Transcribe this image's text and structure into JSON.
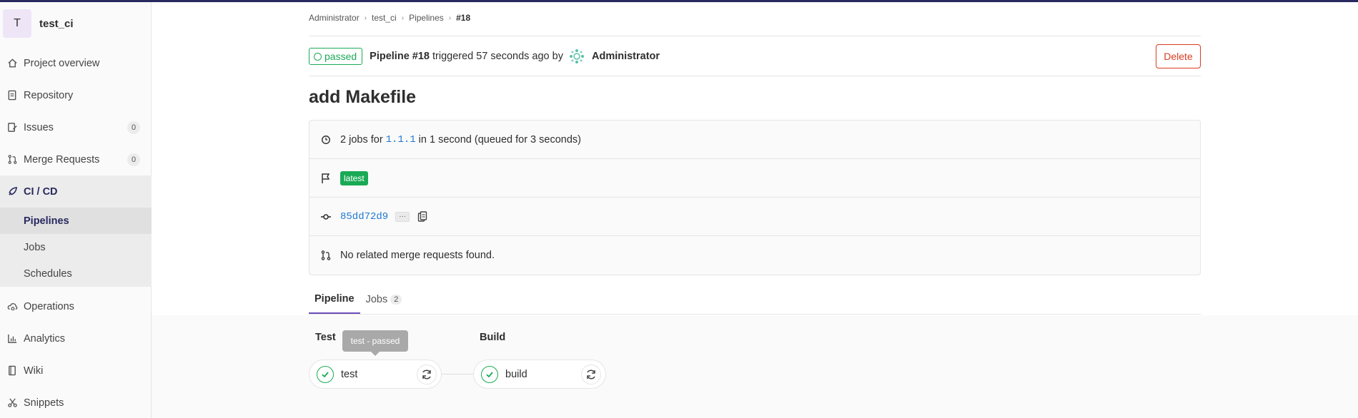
{
  "project": {
    "avatar_letter": "T",
    "name": "test_ci"
  },
  "sidebar": {
    "items": [
      {
        "label": "Project overview",
        "icon": "home-icon"
      },
      {
        "label": "Repository",
        "icon": "document-icon"
      },
      {
        "label": "Issues",
        "icon": "issues-icon",
        "count": "0"
      },
      {
        "label": "Merge Requests",
        "icon": "merge-request-icon",
        "count": "0"
      },
      {
        "label": "CI / CD",
        "icon": "rocket-icon"
      },
      {
        "label": "Operations",
        "icon": "cloud-gear-icon"
      },
      {
        "label": "Analytics",
        "icon": "chart-icon"
      },
      {
        "label": "Wiki",
        "icon": "book-icon"
      },
      {
        "label": "Snippets",
        "icon": "scissors-icon"
      }
    ],
    "cicd_sub": [
      "Pipelines",
      "Jobs",
      "Schedules"
    ]
  },
  "breadcrumb": [
    "Administrator",
    "test_ci",
    "Pipelines",
    "#18"
  ],
  "pipeline": {
    "status": "passed",
    "number": "Pipeline #18",
    "triggered_text": "triggered 57 seconds ago by",
    "user": "Administrator",
    "delete_label": "Delete",
    "title": "add Makefile"
  },
  "info": {
    "jobs_prefix": "2 jobs for",
    "ref": "1.1.1",
    "jobs_suffix": "in 1 second (queued for 3 seconds)",
    "tag": "latest",
    "commit_sha": "85dd72d9",
    "mr_text": "No related merge requests found."
  },
  "tabs": [
    {
      "label": "Pipeline"
    },
    {
      "label": "Jobs",
      "count": "2"
    }
  ],
  "graph": {
    "stages": [
      {
        "name": "Test",
        "job": "test"
      },
      {
        "name": "Build",
        "job": "build"
      }
    ],
    "tooltip": "test - passed"
  },
  "colors": {
    "success": "#1aaa55",
    "danger": "#db3b21",
    "link": "#1f78d1",
    "brand": "#292961"
  }
}
